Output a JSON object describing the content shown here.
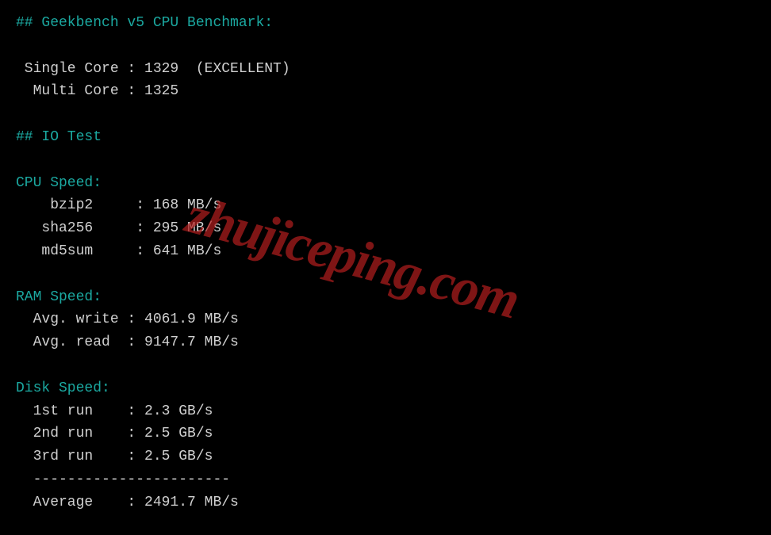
{
  "watermark": "zhujiceping.com",
  "sections": {
    "geekbench": {
      "heading": "## Geekbench v5 CPU Benchmark:",
      "single_core": " Single Core : 1329  (EXCELLENT)",
      "multi_core": "  Multi Core : 1325"
    },
    "iotest": {
      "heading": "## IO Test"
    },
    "cpu_speed": {
      "heading": "CPU Speed:",
      "bzip2": "    bzip2     : 168 MB/s",
      "sha256": "   sha256     : 295 MB/s",
      "md5sum": "   md5sum     : 641 MB/s"
    },
    "ram_speed": {
      "heading": "RAM Speed:",
      "avg_write": "  Avg. write : 4061.9 MB/s",
      "avg_read": "  Avg. read  : 9147.7 MB/s"
    },
    "disk_speed": {
      "heading": "Disk Speed:",
      "run1": "  1st run    : 2.3 GB/s",
      "run2": "  2nd run    : 2.5 GB/s",
      "run3": "  3rd run    : 2.5 GB/s",
      "divider": "  -----------------------",
      "average": "  Average    : 2491.7 MB/s"
    }
  }
}
